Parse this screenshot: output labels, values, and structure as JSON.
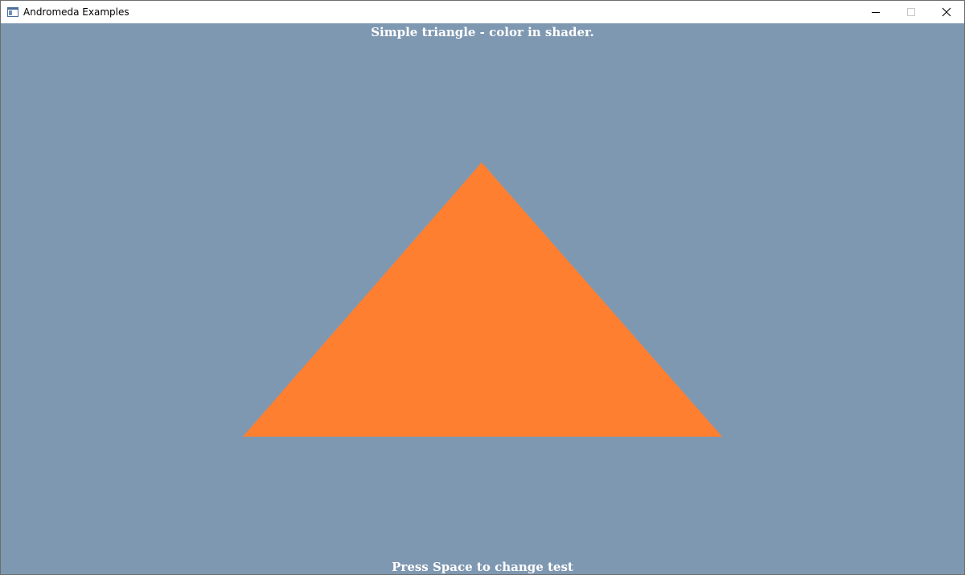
{
  "window": {
    "title": "Andromeda Examples",
    "background_color": "#7f98b1"
  },
  "controls": {
    "minimize_icon": "minimize-icon",
    "maximize_icon": "maximize-icon",
    "close_icon": "close-icon"
  },
  "scene": {
    "heading": "Simple triangle - color in shader.",
    "footer": "Press Space to change test",
    "triangle_color": "#ff7f31"
  }
}
